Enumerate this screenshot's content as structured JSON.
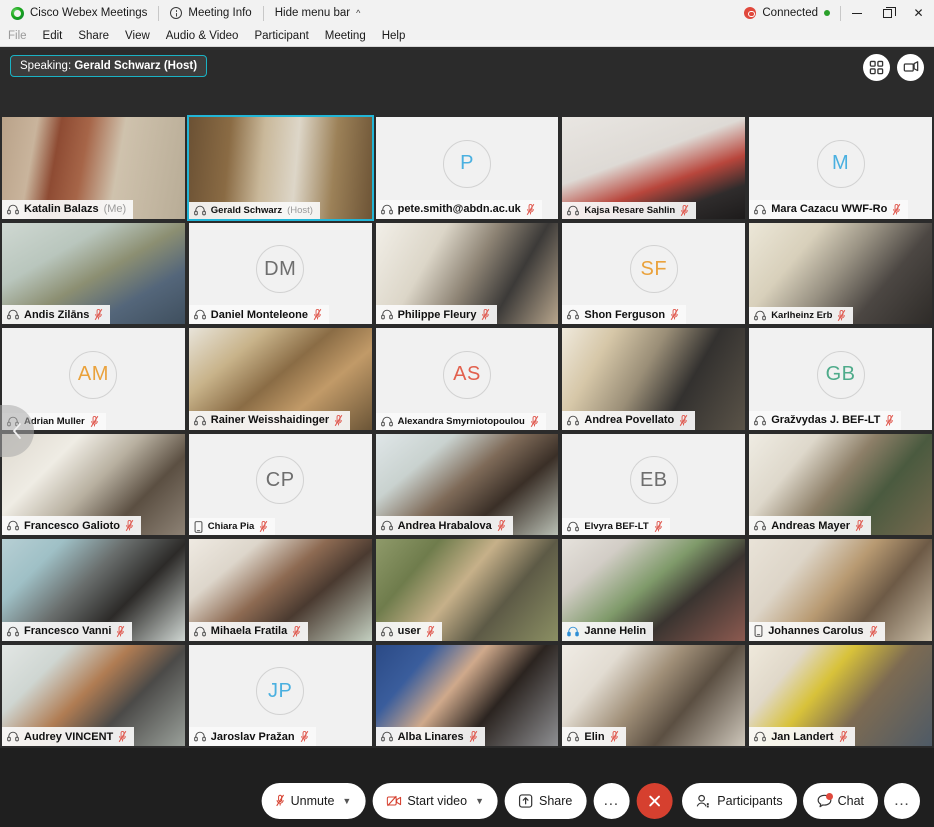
{
  "window": {
    "app_title": "Cisco Webex Meetings",
    "meeting_info_label": "Meeting Info",
    "hide_menu_bar_label": "Hide menu bar",
    "connection_status": "Connected",
    "minimize_label": "Minimize",
    "maximize_label": "Restore",
    "close_label": "Close"
  },
  "menubar": {
    "items": [
      {
        "label": "File"
      },
      {
        "label": "Edit"
      },
      {
        "label": "Share"
      },
      {
        "label": "View"
      },
      {
        "label": "Audio & Video"
      },
      {
        "label": "Participant"
      },
      {
        "label": "Meeting"
      },
      {
        "label": "Help"
      }
    ]
  },
  "stage": {
    "speaking_prefix": "Speaking:",
    "speaking_name": "Gerald Schwarz (Host)",
    "layout_button": "grid-layout-icon",
    "fullscreen_button": "float-view-icon",
    "nav_prev_label": "Previous page"
  },
  "colors": {
    "active_speaker_border": "#22b5d6",
    "mute_red": "#e05a50",
    "end_call_red": "#d6402f",
    "connected_green": "#2aa02a",
    "chat_badge_red": "#e0483c"
  },
  "participants": [
    {
      "name": "Katalin Balazs",
      "suffix": "(Me)",
      "video": true,
      "audio_icon": "headset",
      "muted": false,
      "active": false,
      "bg": "katalin",
      "label_size": "normal"
    },
    {
      "name": "Gerald Schwarz",
      "suffix": "(Host)",
      "video": true,
      "audio_icon": "headset",
      "muted": false,
      "active": true,
      "bg": "gerald",
      "label_size": "small"
    },
    {
      "name": "pete.smith@abdn.ac.uk",
      "suffix": "",
      "video": false,
      "audio_icon": "headset",
      "muted": true,
      "active": false,
      "initials": "P",
      "avatar_color": "#4ab0e0",
      "label_size": "normal"
    },
    {
      "name": "Kajsa Resare Sahlin",
      "suffix": "",
      "video": true,
      "audio_icon": "headset",
      "muted": true,
      "active": false,
      "bg": "kajsa",
      "label_size": "small"
    },
    {
      "name": "Mara Cazacu WWF-Ro",
      "suffix": "",
      "video": false,
      "audio_icon": "headset",
      "muted": true,
      "active": false,
      "initials": "M",
      "avatar_color": "#4ab0e0",
      "label_size": "normal"
    },
    {
      "name": "Andis Zilāns",
      "suffix": "",
      "video": true,
      "audio_icon": "headset",
      "muted": true,
      "active": false,
      "bg": "andis",
      "label_size": "normal"
    },
    {
      "name": "Daniel Monteleone",
      "suffix": "",
      "video": false,
      "audio_icon": "headset",
      "muted": true,
      "active": false,
      "initials": "DM",
      "avatar_color": "#6e6e6e",
      "label_size": "normal"
    },
    {
      "name": "Philippe Fleury",
      "suffix": "",
      "video": true,
      "audio_icon": "headset",
      "muted": true,
      "active": false,
      "bg": "philippe",
      "label_size": "normal"
    },
    {
      "name": "Shon Ferguson",
      "suffix": "",
      "video": false,
      "audio_icon": "headset",
      "muted": true,
      "active": false,
      "initials": "SF",
      "avatar_color": "#eaa23c",
      "label_size": "normal"
    },
    {
      "name": "Karlheinz Erb",
      "suffix": "",
      "video": true,
      "audio_icon": "headset",
      "muted": true,
      "active": false,
      "bg": "karlheinz",
      "label_size": "small"
    },
    {
      "name": "Adrian Muller",
      "suffix": "",
      "video": false,
      "audio_icon": "headset",
      "muted": true,
      "active": false,
      "initials": "AM",
      "avatar_color": "#eaa23c",
      "label_size": "small"
    },
    {
      "name": "Rainer Weisshaidinger",
      "suffix": "",
      "video": true,
      "audio_icon": "headset",
      "muted": true,
      "active": false,
      "bg": "rainer",
      "label_size": "normal"
    },
    {
      "name": "Alexandra Smyrniotopoulou",
      "suffix": "",
      "video": false,
      "audio_icon": "headset",
      "muted": true,
      "active": false,
      "initials": "AS",
      "avatar_color": "#e2604d",
      "label_size": "small"
    },
    {
      "name": "Andrea Povellato",
      "suffix": "",
      "video": true,
      "audio_icon": "headset",
      "muted": true,
      "active": false,
      "bg": "povellato",
      "label_size": "normal"
    },
    {
      "name": "Gražvydas J. BEF-LT",
      "suffix": "",
      "video": false,
      "audio_icon": "headset",
      "muted": true,
      "active": false,
      "initials": "GB",
      "avatar_color": "#4eab8a",
      "label_size": "normal"
    },
    {
      "name": "Francesco Galioto",
      "suffix": "",
      "video": true,
      "audio_icon": "headset",
      "muted": true,
      "active": false,
      "bg": "galioto",
      "label_size": "normal"
    },
    {
      "name": "Chiara Pia",
      "suffix": "",
      "video": false,
      "audio_icon": "phone",
      "muted": true,
      "active": false,
      "initials": "CP",
      "avatar_color": "#6e6e6e",
      "label_size": "small"
    },
    {
      "name": "Andrea Hrabalova",
      "suffix": "",
      "video": true,
      "audio_icon": "headset",
      "muted": true,
      "active": false,
      "bg": "hrabalova",
      "label_size": "normal"
    },
    {
      "name": "Elvyra BEF-LT",
      "suffix": "",
      "video": false,
      "audio_icon": "headset",
      "muted": true,
      "active": false,
      "initials": "EB",
      "avatar_color": "#6e6e6e",
      "label_size": "small"
    },
    {
      "name": "Andreas Mayer",
      "suffix": "",
      "video": true,
      "audio_icon": "headset",
      "muted": true,
      "active": false,
      "bg": "mayer",
      "label_size": "normal"
    },
    {
      "name": "Francesco Vanni",
      "suffix": "",
      "video": true,
      "audio_icon": "headset",
      "muted": true,
      "active": false,
      "bg": "vanni",
      "label_size": "normal"
    },
    {
      "name": "Mihaela Fratila",
      "suffix": "",
      "video": true,
      "audio_icon": "headset",
      "muted": true,
      "active": false,
      "bg": "fratila",
      "label_size": "normal"
    },
    {
      "name": "user",
      "suffix": "",
      "video": true,
      "audio_icon": "headset",
      "muted": true,
      "active": false,
      "bg": "user",
      "label_size": "normal"
    },
    {
      "name": "Janne Helin",
      "suffix": "",
      "video": true,
      "audio_icon": "headset-active",
      "muted": false,
      "active": false,
      "bg": "janne",
      "label_size": "normal"
    },
    {
      "name": "Johannes Carolus",
      "suffix": "",
      "video": true,
      "audio_icon": "phone",
      "muted": true,
      "active": false,
      "bg": "carolus",
      "label_size": "normal"
    },
    {
      "name": "Audrey VINCENT",
      "suffix": "",
      "video": true,
      "audio_icon": "headset",
      "muted": true,
      "active": false,
      "bg": "audrey",
      "label_size": "normal"
    },
    {
      "name": "Jaroslav Pražan",
      "suffix": "",
      "video": false,
      "audio_icon": "headset",
      "muted": true,
      "active": false,
      "initials": "JP",
      "avatar_color": "#4ab0e0",
      "label_size": "normal"
    },
    {
      "name": "Alba Linares",
      "suffix": "",
      "video": true,
      "audio_icon": "headset",
      "muted": true,
      "active": false,
      "bg": "alba",
      "label_size": "normal"
    },
    {
      "name": "Elin",
      "suffix": "",
      "video": true,
      "audio_icon": "headset",
      "muted": true,
      "active": false,
      "bg": "elin",
      "label_size": "normal"
    },
    {
      "name": "Jan Landert",
      "suffix": "",
      "video": true,
      "audio_icon": "headset",
      "muted": true,
      "active": false,
      "bg": "landert",
      "label_size": "normal"
    }
  ],
  "toolbar": {
    "unmute_label": "Unmute",
    "start_video_label": "Start video",
    "share_label": "Share",
    "more_label": "…",
    "end_label": "End meeting",
    "participants_label": "Participants",
    "chat_label": "Chat",
    "more_right_label": "…"
  }
}
